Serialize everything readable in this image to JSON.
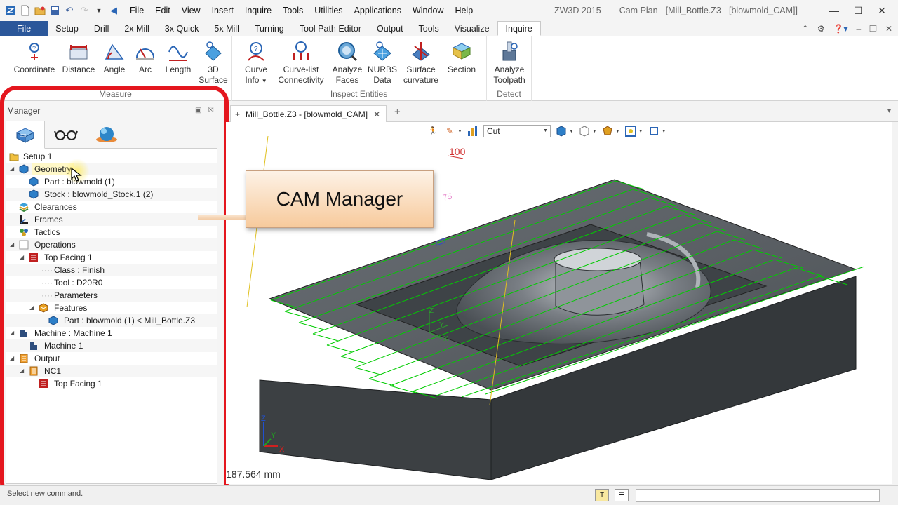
{
  "app": {
    "product": "ZW3D 2015",
    "document": "Cam Plan - [Mill_Bottle.Z3 - [blowmold_CAM]]"
  },
  "menu": [
    "File",
    "Edit",
    "View",
    "Insert",
    "Inquire",
    "Tools",
    "Utilities",
    "Applications",
    "Window",
    "Help"
  ],
  "tabs": [
    "File",
    "Setup",
    "Drill",
    "2x Mill",
    "3x Quick",
    "5x Mill",
    "Turning",
    "Tool Path Editor",
    "Output",
    "Tools",
    "Visualize",
    "Inquire"
  ],
  "active_tab": "Inquire",
  "ribbon": {
    "measure": {
      "label": "Measure",
      "buttons": [
        {
          "l1": "Coordinate",
          "l2": ""
        },
        {
          "l1": "Distance",
          "l2": ""
        },
        {
          "l1": "Angle",
          "l2": ""
        },
        {
          "l1": "Arc",
          "l2": ""
        },
        {
          "l1": "Length",
          "l2": ""
        },
        {
          "l1": "3D",
          "l2": "Surface"
        }
      ]
    },
    "inspect": {
      "label": "Inspect Entities",
      "buttons": [
        {
          "l1": "Curve",
          "l2": "Info"
        },
        {
          "l1": "Curve-list",
          "l2": "Connectivity"
        },
        {
          "l1": "Analyze",
          "l2": "Faces"
        },
        {
          "l1": "NURBS",
          "l2": "Data"
        },
        {
          "l1": "Surface",
          "l2": "curvature"
        },
        {
          "l1": "Section",
          "l2": ""
        }
      ]
    },
    "detect": {
      "label": "Detect",
      "buttons": [
        {
          "l1": "Analyze",
          "l2": "Toolpath"
        }
      ]
    }
  },
  "manager": {
    "title": "Manager",
    "tree": [
      {
        "label": "Setup 1",
        "level": 0,
        "icon": "folder-icon",
        "expander": ""
      },
      {
        "label": "Geometry",
        "level": 1,
        "icon": "cube-icon",
        "expander": "◢",
        "highlight": true
      },
      {
        "label": "Part : blowmold (1)",
        "level": 2,
        "icon": "cube-icon",
        "expander": ""
      },
      {
        "label": "Stock : blowmold_Stock.1 (2)",
        "level": 2,
        "icon": "cube-icon",
        "expander": ""
      },
      {
        "label": "Clearances",
        "level": 1,
        "icon": "layers-icon",
        "expander": ""
      },
      {
        "label": "Frames",
        "level": 1,
        "icon": "frame-icon",
        "expander": ""
      },
      {
        "label": "Tactics",
        "level": 1,
        "icon": "tactics-icon",
        "expander": ""
      },
      {
        "label": "Operations",
        "level": 1,
        "icon": "operations-icon",
        "expander": "◢"
      },
      {
        "label": "Top Facing 1",
        "level": 2,
        "icon": "facing-op-icon",
        "expander": "◢"
      },
      {
        "label": "Class : Finish",
        "level": 3,
        "icon": "",
        "expander": "",
        "dotted": true
      },
      {
        "label": "Tool : D20R0",
        "level": 3,
        "icon": "",
        "expander": "",
        "dotted": true
      },
      {
        "label": "Parameters",
        "level": 3,
        "icon": "",
        "expander": "",
        "dotted": true
      },
      {
        "label": "Features",
        "level": 3,
        "icon": "features-icon",
        "expander": "◢"
      },
      {
        "label": "Part : blowmold (1) < Mill_Bottle.Z3",
        "level": 4,
        "icon": "cube-icon",
        "expander": ""
      },
      {
        "label": "Machine : Machine 1",
        "level": 1,
        "icon": "machine-icon",
        "expander": "◢"
      },
      {
        "label": "Machine 1",
        "level": 2,
        "icon": "machine-icon",
        "expander": ""
      },
      {
        "label": "Output",
        "level": 1,
        "icon": "output-icon",
        "expander": "◢"
      },
      {
        "label": "NC1",
        "level": 2,
        "icon": "output-icon",
        "expander": "◢"
      },
      {
        "label": "Top Facing 1",
        "level": 3,
        "icon": "facing-op-icon",
        "expander": ""
      }
    ]
  },
  "document_tab": "Mill_Bottle.Z3 - [blowmold_CAM]",
  "viewport": {
    "filter_value": "Cut",
    "measure": "187.564 mm",
    "dim_100": "100",
    "dim_75": "75",
    "axis_z": "Z",
    "axis_y": "Y",
    "axis_x": "X"
  },
  "callout": "CAM Manager",
  "status": "Select new command.",
  "colors": {
    "file_tab": "#2b579a",
    "outline": "#e4161e",
    "toolpath": "#00cc00"
  }
}
